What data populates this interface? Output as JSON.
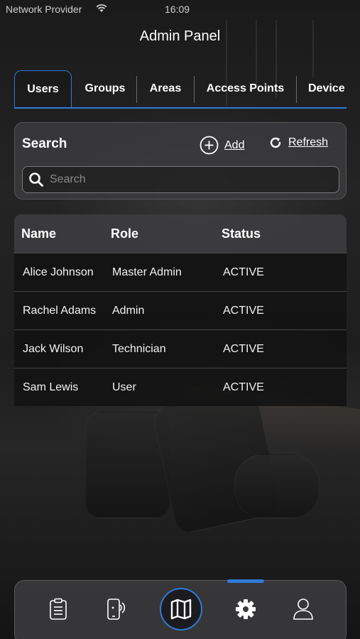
{
  "status_bar": {
    "carrier": "Network Provider",
    "time": "16:09"
  },
  "header": {
    "title": "Admin Panel"
  },
  "tabs": [
    {
      "label": "Users",
      "active": true
    },
    {
      "label": "Groups",
      "active": false
    },
    {
      "label": "Areas",
      "active": false
    },
    {
      "label": "Access Points",
      "active": false
    },
    {
      "label": "Device",
      "active": false
    }
  ],
  "search_panel": {
    "heading": "Search",
    "add_label": "Add",
    "refresh_label": "Refresh",
    "search_placeholder": "Search",
    "search_value": ""
  },
  "users_table": {
    "columns": [
      "Name",
      "Role",
      "Status"
    ],
    "rows": [
      {
        "name": "Alice Johnson",
        "role": "Master Admin",
        "status": "ACTIVE"
      },
      {
        "name": "Rachel Adams",
        "role": "Admin",
        "status": "ACTIVE"
      },
      {
        "name": "Jack Wilson",
        "role": "Technician",
        "status": "ACTIVE"
      },
      {
        "name": "Sam Lewis",
        "role": "User",
        "status": "ACTIVE"
      }
    ]
  },
  "bottom_nav": {
    "items": [
      {
        "icon": "clipboard-icon",
        "active": false
      },
      {
        "icon": "nfc-phone-icon",
        "active": false
      },
      {
        "icon": "map-icon",
        "active": false
      },
      {
        "icon": "gear-icon",
        "active": true
      },
      {
        "icon": "user-icon",
        "active": false
      }
    ]
  },
  "colors": {
    "accent": "#2f7ad8",
    "panel": "#3c3c3e",
    "text": "#ffffff"
  }
}
